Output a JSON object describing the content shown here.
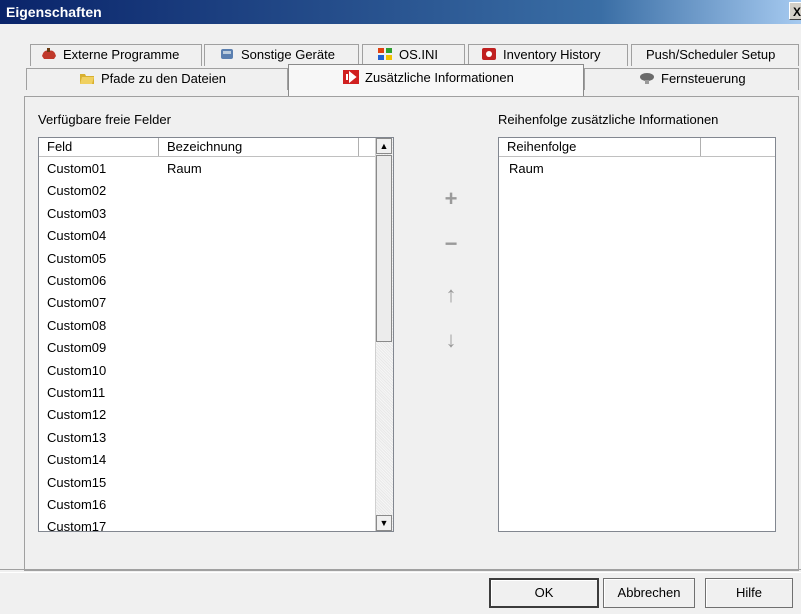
{
  "window": {
    "title": "Eigenschaften",
    "close_glyph": "X"
  },
  "tabs_row1": [
    {
      "label": "Externe Programme",
      "icon": "app-icon",
      "color": "#c0392b"
    },
    {
      "label": "Sonstige Geräte",
      "icon": "device-icon",
      "color": "#5a7fb0"
    },
    {
      "label": "OS.INI",
      "icon": "windows-flag-icon",
      "color": "#e04010"
    },
    {
      "label": "Inventory History",
      "icon": "inventory-icon",
      "color": "#c02020"
    },
    {
      "label": "Push/Scheduler Setup",
      "icon": "",
      "color": ""
    }
  ],
  "tabs_row2": [
    {
      "label": "Pfade zu den Dateien",
      "icon": "folder-icon",
      "color": "#d8b030"
    },
    {
      "label": "Zusätzliche Informationen",
      "icon": "info-arrow-icon",
      "color": "#d02020",
      "active": true
    },
    {
      "label": "Fernsteuerung",
      "icon": "remote-icon",
      "color": "#6a6a6a"
    }
  ],
  "available": {
    "label": "Verfügbare freie Felder",
    "columns": [
      "Feld",
      "Bezeichnung"
    ],
    "rows": [
      [
        "Custom01",
        "Raum"
      ],
      [
        "Custom02",
        ""
      ],
      [
        "Custom03",
        ""
      ],
      [
        "Custom04",
        ""
      ],
      [
        "Custom05",
        ""
      ],
      [
        "Custom06",
        ""
      ],
      [
        "Custom07",
        ""
      ],
      [
        "Custom08",
        ""
      ],
      [
        "Custom09",
        ""
      ],
      [
        "Custom10",
        ""
      ],
      [
        "Custom11",
        ""
      ],
      [
        "Custom12",
        ""
      ],
      [
        "Custom13",
        ""
      ],
      [
        "Custom14",
        ""
      ],
      [
        "Custom15",
        ""
      ],
      [
        "Custom16",
        ""
      ],
      [
        "Custom17",
        ""
      ]
    ],
    "scroll_up": "▲",
    "scroll_down": "▼"
  },
  "order": {
    "label": "Reihenfolge zusätzliche Informationen",
    "columns": [
      "Reihenfolge",
      ""
    ],
    "rows": [
      "Raum"
    ]
  },
  "actions": {
    "add": "+",
    "remove": "−",
    "up": "↑",
    "down": "↓"
  },
  "buttons": {
    "ok": "OK",
    "cancel": "Abbrechen",
    "help": "Hilfe"
  }
}
